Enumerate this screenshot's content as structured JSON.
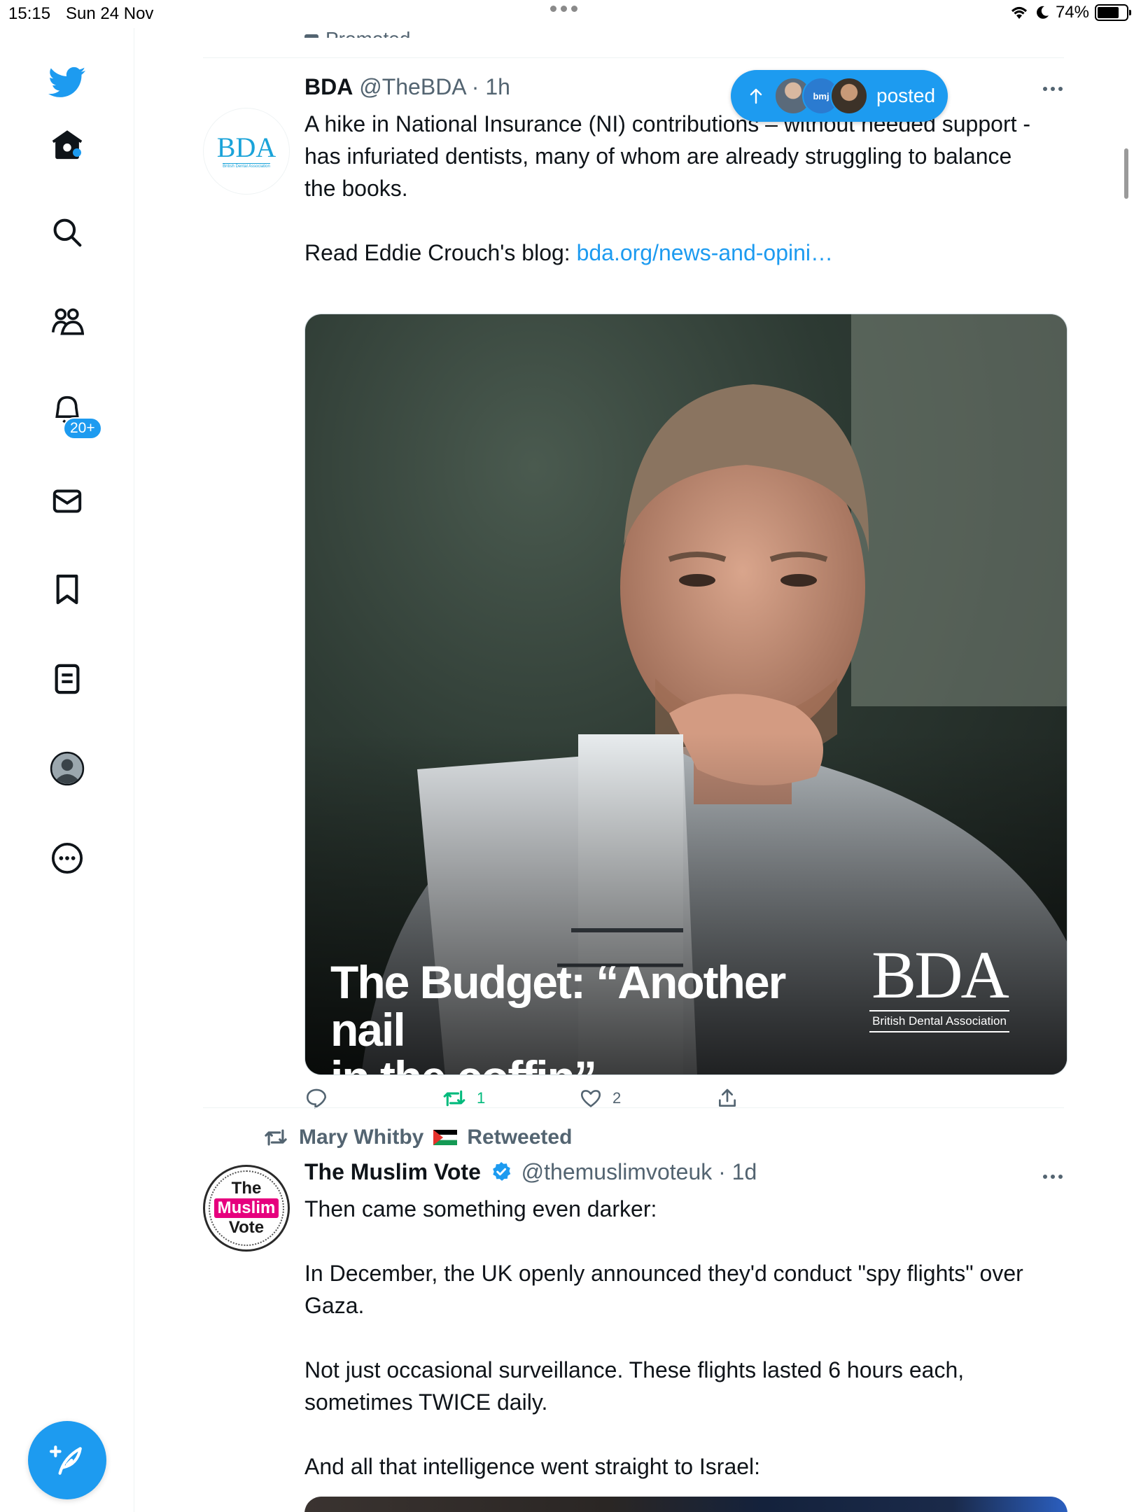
{
  "status_bar": {
    "time": "15:15",
    "date": "Sun 24 Nov",
    "battery": "74%"
  },
  "nav": {
    "items": [
      {
        "icon": "twitter-logo-icon"
      },
      {
        "icon": "home-icon"
      },
      {
        "icon": "search-icon"
      },
      {
        "icon": "communities-icon"
      },
      {
        "icon": "notifications-icon",
        "badge": "20+"
      },
      {
        "icon": "messages-icon"
      },
      {
        "icon": "bookmarks-icon"
      },
      {
        "icon": "lists-icon"
      },
      {
        "icon": "profile-icon"
      },
      {
        "icon": "more-icon"
      }
    ],
    "notifications_badge": "20+"
  },
  "feed": {
    "promoted_label": "Promoted",
    "new_posts_pill": {
      "label": "posted",
      "avatar_text": "bmj"
    },
    "tweets": [
      {
        "name": "BDA",
        "handle": "@TheBDA",
        "time": "1h",
        "avatar_text": "BDA",
        "avatar_subtext": "British Dental Association",
        "text": [
          "A hike in National Insurance (NI) contributions – without needed support - has infuriated dentists, many of whom are already struggling to balance the books."
        ],
        "text_prefix": "Read Eddie Crouch's blog: ",
        "link": "bda.org/news-and-opini…",
        "media": {
          "title_line1": "The Budget: “Another nail",
          "title_line2": "in the coffin”",
          "brand": "BDA",
          "brand_sub": "British Dental Association"
        },
        "stats": {
          "replies": "",
          "retweets": "1",
          "likes": "2"
        }
      },
      {
        "retweeted_by": "Mary Whitby",
        "retweeted_label": "Retweeted",
        "name": "The Muslim Vote",
        "handle": "@themuslimvoteuk",
        "time": "1d",
        "avatar_text": [
          "The",
          "Muslim",
          "Vote"
        ],
        "text": [
          "Then came something even darker:",
          "In December, the UK openly announced they'd conduct \"spy flights\" over Gaza.",
          "Not just occasional surveillance. These flights lasted 6 hours each, sometimes TWICE daily.",
          "And all that intelligence went straight to Israel:"
        ]
      }
    ]
  },
  "colors": {
    "accent": "#1d9bf0",
    "retweet_green": "#00ba7c",
    "secondary_text": "#536471",
    "muslim_vote_pink": "#e6007e"
  }
}
